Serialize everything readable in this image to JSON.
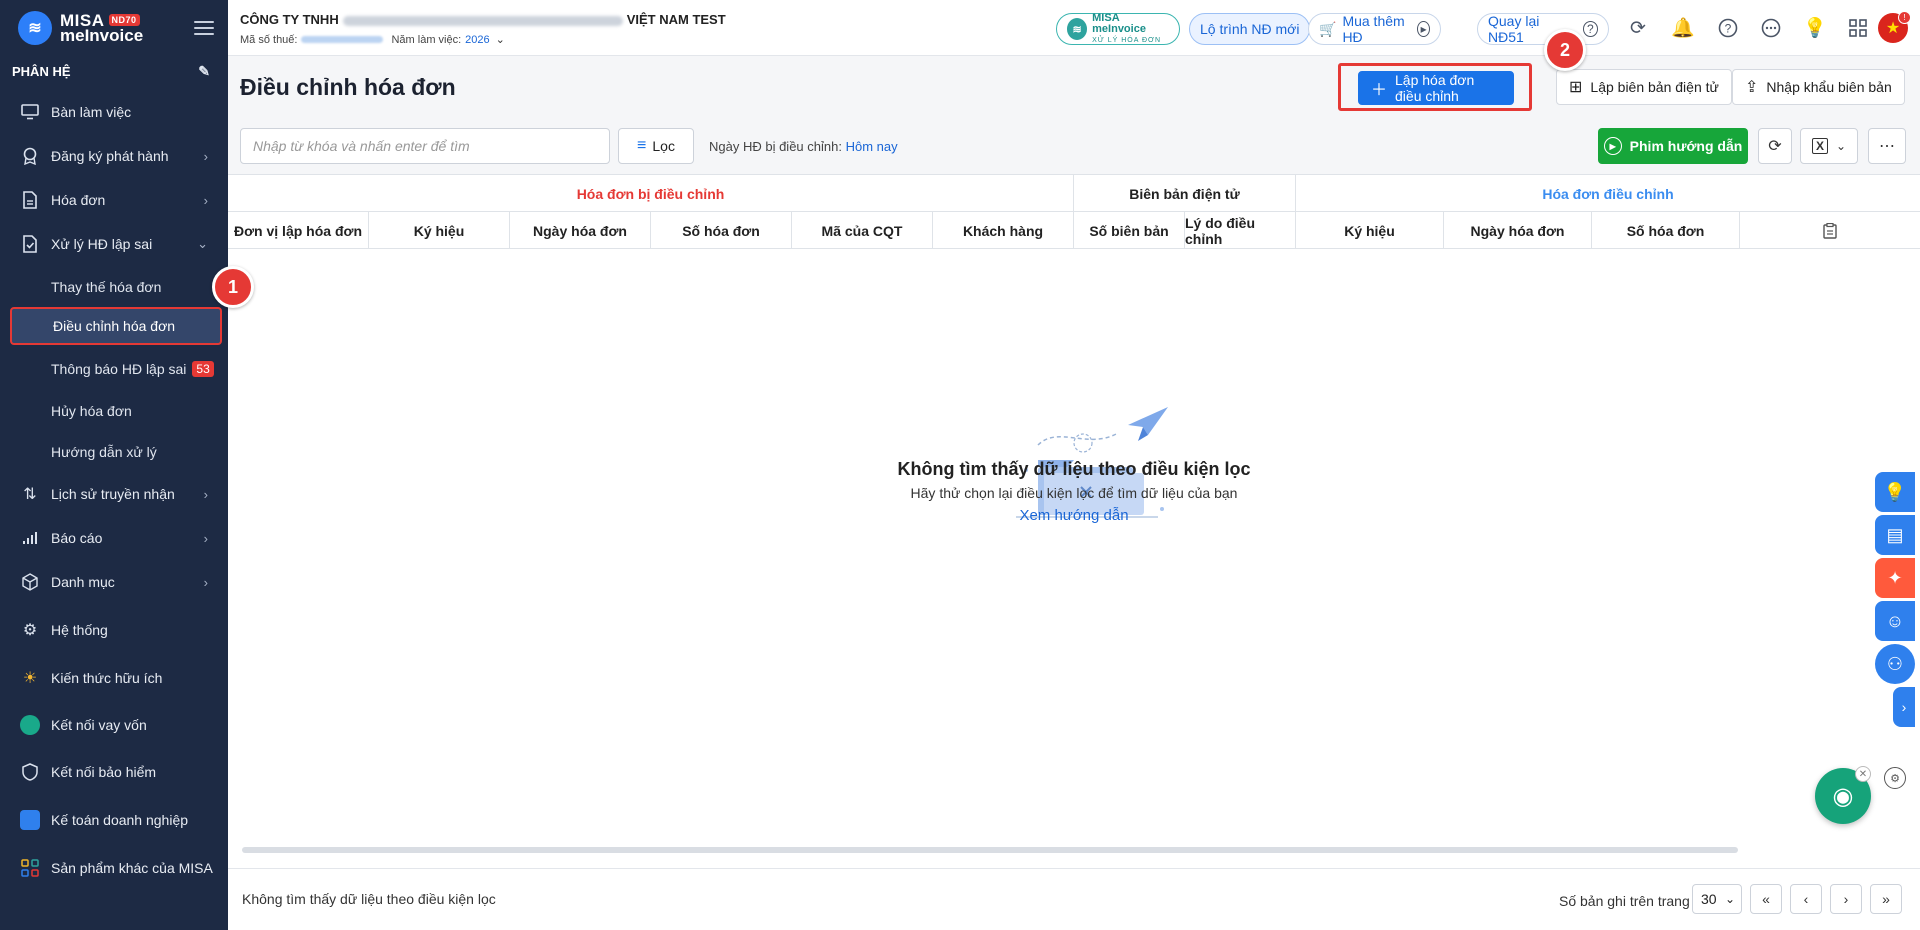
{
  "app": {
    "logo_line1": "MISA",
    "logo_line2": "meInvoice",
    "logo_badge": "ND70",
    "module_label": "PHÂN HỆ"
  },
  "sidebar": {
    "items": [
      {
        "label": "Bàn làm việc",
        "icon": "monitor-icon"
      },
      {
        "label": "Đăng ký phát hành",
        "icon": "badge-icon"
      },
      {
        "label": "Hóa đơn",
        "icon": "document-icon"
      },
      {
        "label": "Xử lý HĐ lập sai",
        "icon": "check-document-icon"
      },
      {
        "label": "Lịch sử truyền nhận",
        "icon": "transfer-icon"
      },
      {
        "label": "Báo cáo",
        "icon": "bar-chart-icon"
      },
      {
        "label": "Danh mục",
        "icon": "cube-icon"
      },
      {
        "label": "Hệ thống",
        "icon": "gear-icon"
      },
      {
        "label": "Kiến thức hữu ích",
        "icon": "lightbulb-icon"
      },
      {
        "label": "Kết nối vay vốn",
        "icon": "loan-icon"
      },
      {
        "label": "Kết nối bảo hiểm",
        "icon": "shield-icon"
      },
      {
        "label": "Kế toán doanh nghiệp",
        "icon": "accounting-icon"
      },
      {
        "label": "Sản phẩm khác của MISA",
        "icon": "apps-icon"
      }
    ],
    "subitems": [
      {
        "label": "Thay thế hóa đơn"
      },
      {
        "label": "Điều chỉnh hóa đơn"
      },
      {
        "label": "Thông báo HĐ lập sai",
        "badge": "53"
      },
      {
        "label": "Hủy hóa đơn"
      },
      {
        "label": "Hướng dẫn xử lý"
      }
    ]
  },
  "steps": {
    "one": "1",
    "two": "2"
  },
  "topbar": {
    "company_prefix": "CÔNG TY TNHH",
    "company_suffix": "VIỆT NAM TEST",
    "tax_label": "Mã số thuế:",
    "year_label": "Năm làm việc:",
    "year_value": "2026",
    "brand_pill_line1": "MISA meInvoice",
    "brand_pill_line2": "XỬ LÝ HÓA ĐƠN",
    "roadmap_label": "Lộ trình NĐ mới",
    "buy_label": "Mua thêm HĐ",
    "back_label": "Quay lại NĐ51"
  },
  "page": {
    "title": "Điều chỉnh hóa đơn",
    "create_adjust_label": "Lập hóa đơn điều chỉnh",
    "create_record_label": "Lập biên bản điện tử",
    "import_record_label": "Nhập khẩu biên bản"
  },
  "toolbar": {
    "search_placeholder": "Nhập từ khóa và nhấn enter để tìm",
    "filter_label": "Lọc",
    "date_label": "Ngày HĐ bị điều chỉnh:",
    "date_value": "Hôm nay",
    "guide_video_label": "Phim hướng dẫn"
  },
  "table": {
    "groups": [
      "Hóa đơn bị điều chỉnh",
      "Biên bản điện tử",
      "Hóa đơn điều chỉnh"
    ],
    "columns": [
      "Đơn vị lập hóa đơn",
      "Ký hiệu",
      "Ngày hóa đơn",
      "Số hóa đơn",
      "Mã của CQT",
      "Khách hàng",
      "Số biên bản",
      "Lý do điều chỉnh",
      "Ký hiệu",
      "Ngày hóa đơn",
      "Số hóa đơn"
    ],
    "empty_title": "Không tìm thấy dữ liệu theo điều kiện lọc",
    "empty_sub": "Hãy thử chọn lại điều kiện lọc để tìm dữ liệu của bạn",
    "empty_link": "Xem hướng dẫn"
  },
  "footer": {
    "status": "Không tìm thấy dữ liệu theo điều kiện lọc",
    "page_size_label": "Số bản ghi trên trang",
    "page_size_value": "30"
  },
  "colors": {
    "sidebar_bg": "#1d2a44",
    "primary": "#1a73e8",
    "highlight": "#e53935",
    "green": "#17a63a"
  }
}
